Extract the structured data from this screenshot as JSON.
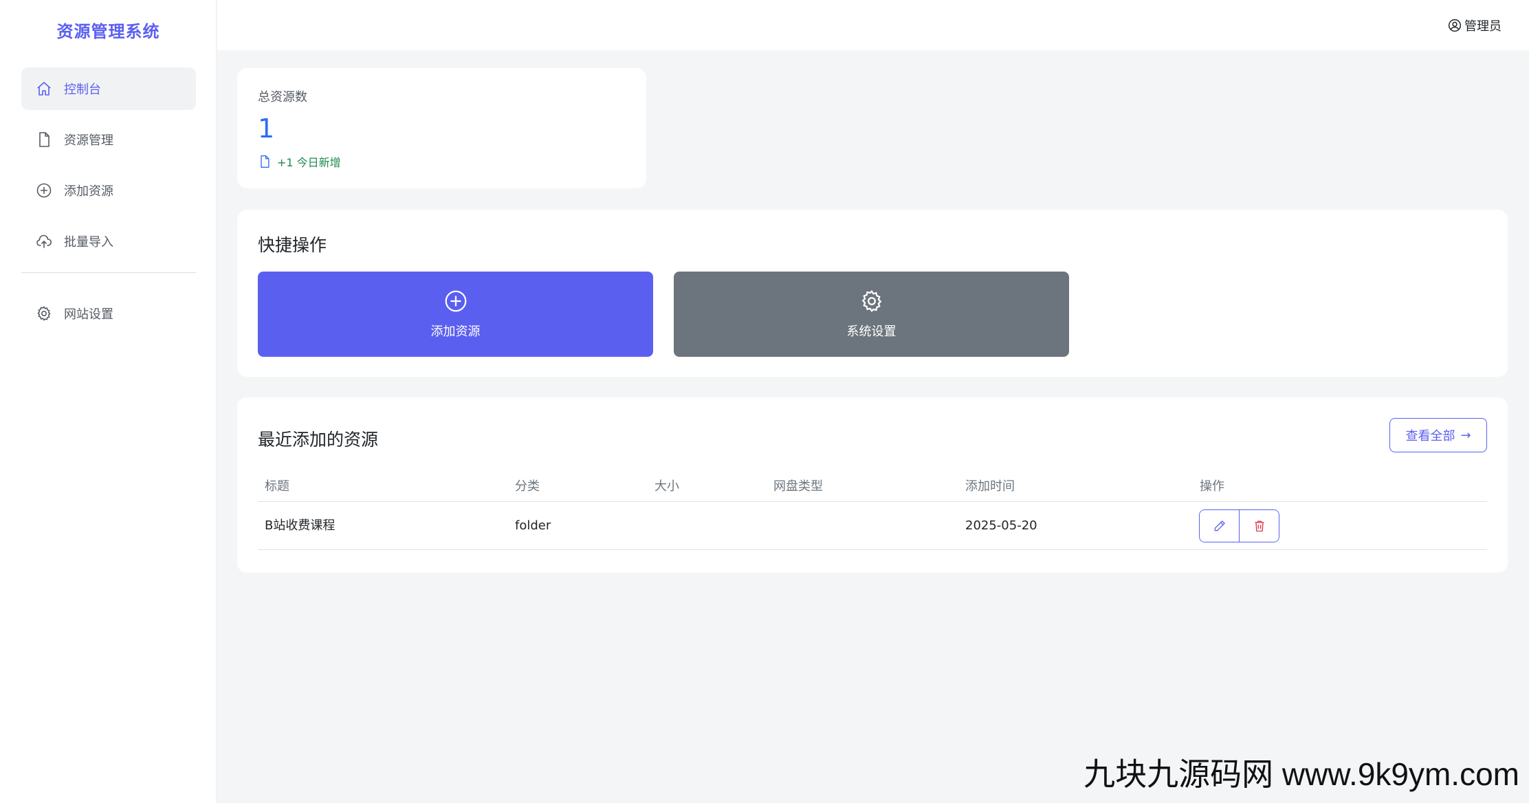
{
  "brand": "资源管理系统",
  "sidebar": {
    "items": [
      {
        "label": "控制台",
        "icon": "home-icon",
        "active": true
      },
      {
        "label": "资源管理",
        "icon": "file-icon"
      },
      {
        "label": "添加资源",
        "icon": "plus-circle-icon"
      },
      {
        "label": "批量导入",
        "icon": "cloud-upload-icon"
      },
      {
        "label": "网站设置",
        "icon": "gear-icon"
      }
    ]
  },
  "header": {
    "user_label": "管理员",
    "user_icon": "user-circle-icon"
  },
  "stats": {
    "label": "总资源数",
    "value": "1",
    "sub": "+1 今日新增"
  },
  "quick": {
    "title": "快捷操作",
    "add_label": "添加资源",
    "settings_label": "系统设置"
  },
  "recent": {
    "title": "最近添加的资源",
    "view_all": "查看全部",
    "columns": [
      "标题",
      "分类",
      "大小",
      "网盘类型",
      "添加时间",
      "操作"
    ],
    "rows": [
      {
        "title": "B站收费课程",
        "category": "folder",
        "size": "",
        "disk": "",
        "time": "2025-05-20"
      }
    ]
  },
  "watermark": "九块九源码网 www.9k9ym.com",
  "colors": {
    "primary": "#5b5ff0",
    "secondary": "#6c757d",
    "stat_value": "#2a6ff0",
    "success": "#1e8a4e",
    "danger": "#dc3545"
  }
}
